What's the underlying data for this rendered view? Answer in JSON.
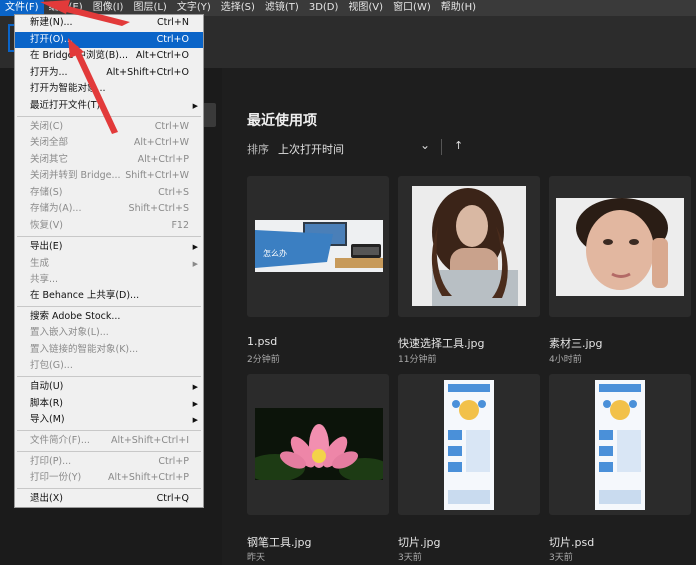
{
  "menubar": {
    "items": [
      "文件(F)",
      "编辑(E)",
      "图像(I)",
      "图层(L)",
      "文字(Y)",
      "选择(S)",
      "滤镜(T)",
      "3D(D)",
      "视图(V)",
      "窗口(W)",
      "帮助(H)"
    ]
  },
  "file_menu": {
    "items": [
      {
        "label": "新建(N)...",
        "shortcut": "Ctrl+N"
      },
      {
        "label": "打开(O)...",
        "shortcut": "Ctrl+O"
      },
      {
        "label": "在 Bridge 中浏览(B)...",
        "shortcut": "Alt+Ctrl+O"
      },
      {
        "label": "打开为...",
        "shortcut": "Alt+Shift+Ctrl+O"
      },
      {
        "label": "打开为智能对象..."
      },
      {
        "label": "最近打开文件(T)"
      },
      {
        "label": "关闭(C)",
        "shortcut": "Ctrl+W"
      },
      {
        "label": "关闭全部",
        "shortcut": "Alt+Ctrl+W"
      },
      {
        "label": "关闭其它",
        "shortcut": "Alt+Ctrl+P"
      },
      {
        "label": "关闭并转到 Bridge...",
        "shortcut": "Shift+Ctrl+W"
      },
      {
        "label": "存储(S)",
        "shortcut": "Ctrl+S"
      },
      {
        "label": "存储为(A)...",
        "shortcut": "Shift+Ctrl+S"
      },
      {
        "label": "恢复(V)",
        "shortcut": "F12"
      },
      {
        "label": "导出(E)"
      },
      {
        "label": "生成"
      },
      {
        "label": "共享..."
      },
      {
        "label": "在 Behance 上共享(D)..."
      },
      {
        "label": "搜索 Adobe Stock..."
      },
      {
        "label": "置入嵌入对象(L)..."
      },
      {
        "label": "置入链接的智能对象(K)..."
      },
      {
        "label": "打包(G)..."
      },
      {
        "label": "自动(U)"
      },
      {
        "label": "脚本(R)"
      },
      {
        "label": "导入(M)"
      },
      {
        "label": "文件简介(F)...",
        "shortcut": "Alt+Shift+Ctrl+I"
      },
      {
        "label": "打印(P)...",
        "shortcut": "Ctrl+P"
      },
      {
        "label": "打印一份(Y)",
        "shortcut": "Alt+Shift+Ctrl+P"
      },
      {
        "label": "退出(X)",
        "shortcut": "Ctrl+Q"
      }
    ]
  },
  "home": {
    "title": "最近使用项",
    "sort_label": "排序",
    "sort_value": "上次打开时间",
    "files": [
      {
        "name": "1.psd",
        "time": "2分钟前"
      },
      {
        "name": "快速选择工具.jpg",
        "time": "11分钟前"
      },
      {
        "name": "素材三.jpg",
        "time": "4小时前"
      },
      {
        "name": "钢笔工具.jpg",
        "time": "昨天"
      },
      {
        "name": "切片.jpg",
        "time": "3天前"
      },
      {
        "name": "切片.psd",
        "time": "3天前"
      }
    ],
    "thumb1_text": "怎么办"
  }
}
